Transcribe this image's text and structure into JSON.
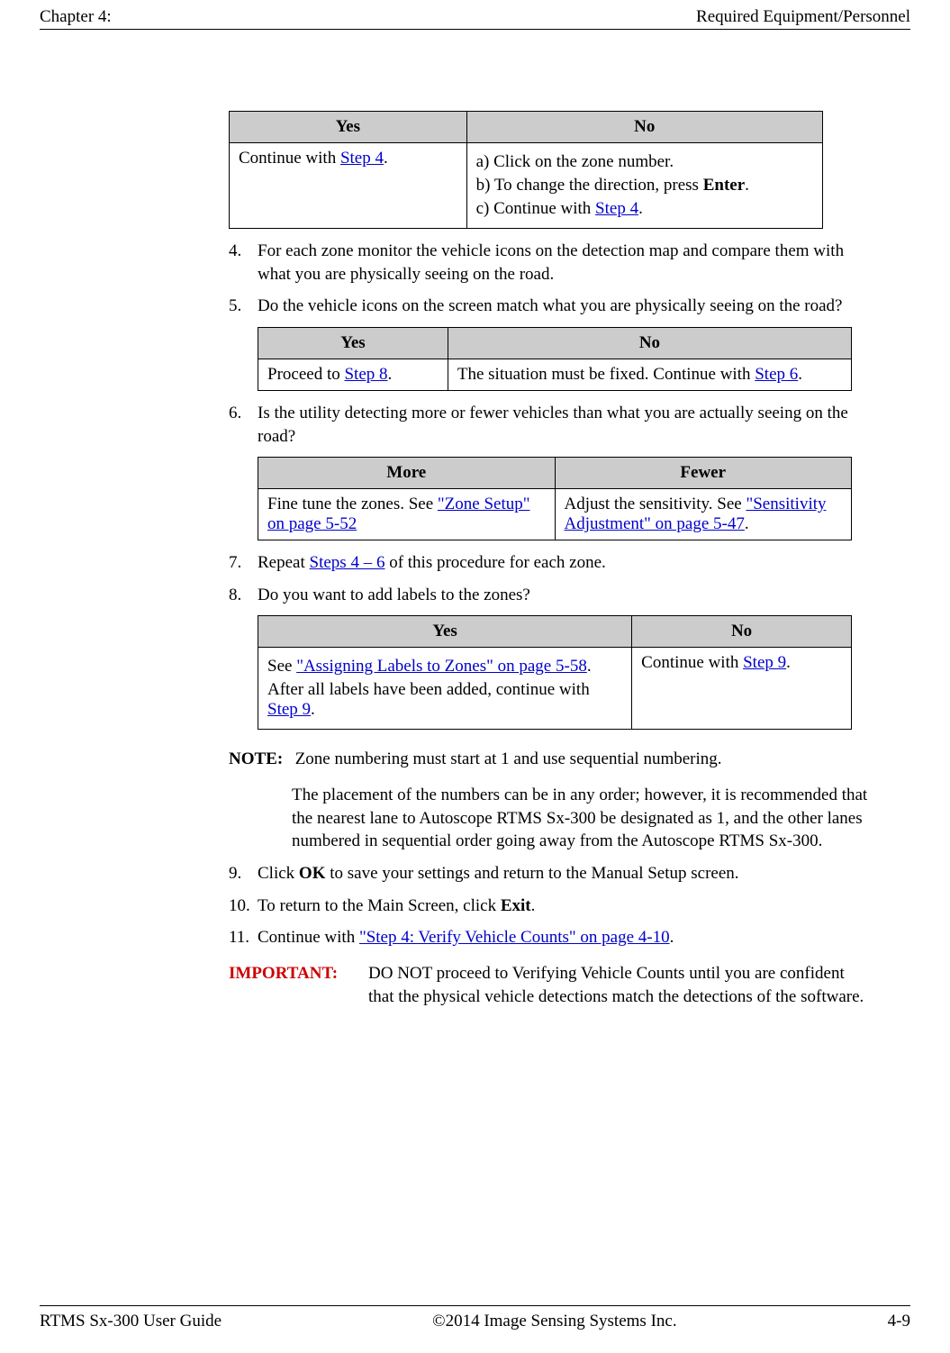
{
  "header": {
    "left": "Chapter 4:",
    "right": "Required Equipment/Personnel"
  },
  "footer": {
    "left": "RTMS Sx-300 User Guide",
    "center": "©2014 Image Sensing Systems Inc.",
    "right": "4-9"
  },
  "table1": {
    "h1": "Yes",
    "h2": "No",
    "yes_pre": "Continue with ",
    "yes_link": "Step 4",
    "yes_post": ".",
    "no_a": "a)  Click on the zone number.",
    "no_b_pre": "b)  To change the direction, press ",
    "no_b_bold": "Enter",
    "no_b_post": ".",
    "no_c_pre": "c)  Continue with ",
    "no_c_link": "Step 4",
    "no_c_post": "."
  },
  "step4": {
    "num": "4.",
    "text": "For each zone monitor the vehicle icons on the detection map and compare them with what you are physically seeing on the road."
  },
  "step5": {
    "num": "5.",
    "text": "Do the vehicle icons on the screen match what you are physically seeing on the road?"
  },
  "table2": {
    "h1": "Yes",
    "h2": "No",
    "yes_pre": "Proceed to ",
    "yes_link": "Step 8",
    "yes_post": ".",
    "no_pre": "The situation must be fixed. Continue with ",
    "no_link": "Step 6",
    "no_post": "."
  },
  "step6": {
    "num": "6.",
    "text": "Is the utility detecting more or fewer vehicles than what you are actually seeing on the road?"
  },
  "table3": {
    "h1": "More",
    "h2": "Fewer",
    "more_pre": "Fine tune the zones. See ",
    "more_link": "\"Zone Setup\" on page 5-52",
    "fewer_pre": "Adjust the sensitivity. See ",
    "fewer_link": "\"Sensitivity Adjustment\" on page 5-47",
    "fewer_post": "."
  },
  "step7": {
    "num": "7.",
    "pre": "Repeat ",
    "link": "Steps 4 – 6",
    "post": " of this procedure for each zone."
  },
  "step8": {
    "num": "8.",
    "text": "Do you want to add labels to the zones?"
  },
  "table4": {
    "h1": "Yes",
    "h2": "No",
    "yes_pre": "See ",
    "yes_link": "\"Assigning Labels to Zones\" on page 5-58",
    "yes_post": ".",
    "yes_line2_pre": "After all labels have been added, continue with ",
    "yes_line2_link": "Step 9",
    "yes_line2_post": ".",
    "no_pre": "Continue with ",
    "no_link": "Step 9",
    "no_post": "."
  },
  "note": {
    "label": "NOTE:",
    "body1": "Zone numbering must start at 1 and use sequential numbering.",
    "body2": "The placement of the numbers can be in any order; however, it is recommended that the nearest lane to Autoscope RTMS Sx-300 be designated as 1, and the other lanes numbered in sequential order going away from the Autoscope RTMS Sx-300."
  },
  "step9": {
    "num": "9.",
    "pre": "Click ",
    "bold": "OK",
    "post": " to save your settings and return to the Manual Setup screen."
  },
  "step10": {
    "num": "10.",
    "pre": "To return to the Main Screen, click ",
    "bold": "Exit",
    "post": "."
  },
  "step11": {
    "num": "11.",
    "pre": "Continue with ",
    "link": "\"Step 4: Verify Vehicle Counts\" on page 4-10",
    "post": "."
  },
  "important": {
    "label": "IMPORTANT:",
    "body": "DO NOT proceed to Verifying Vehicle Counts until you are confident that the physical vehicle detections match the detections of the software."
  }
}
